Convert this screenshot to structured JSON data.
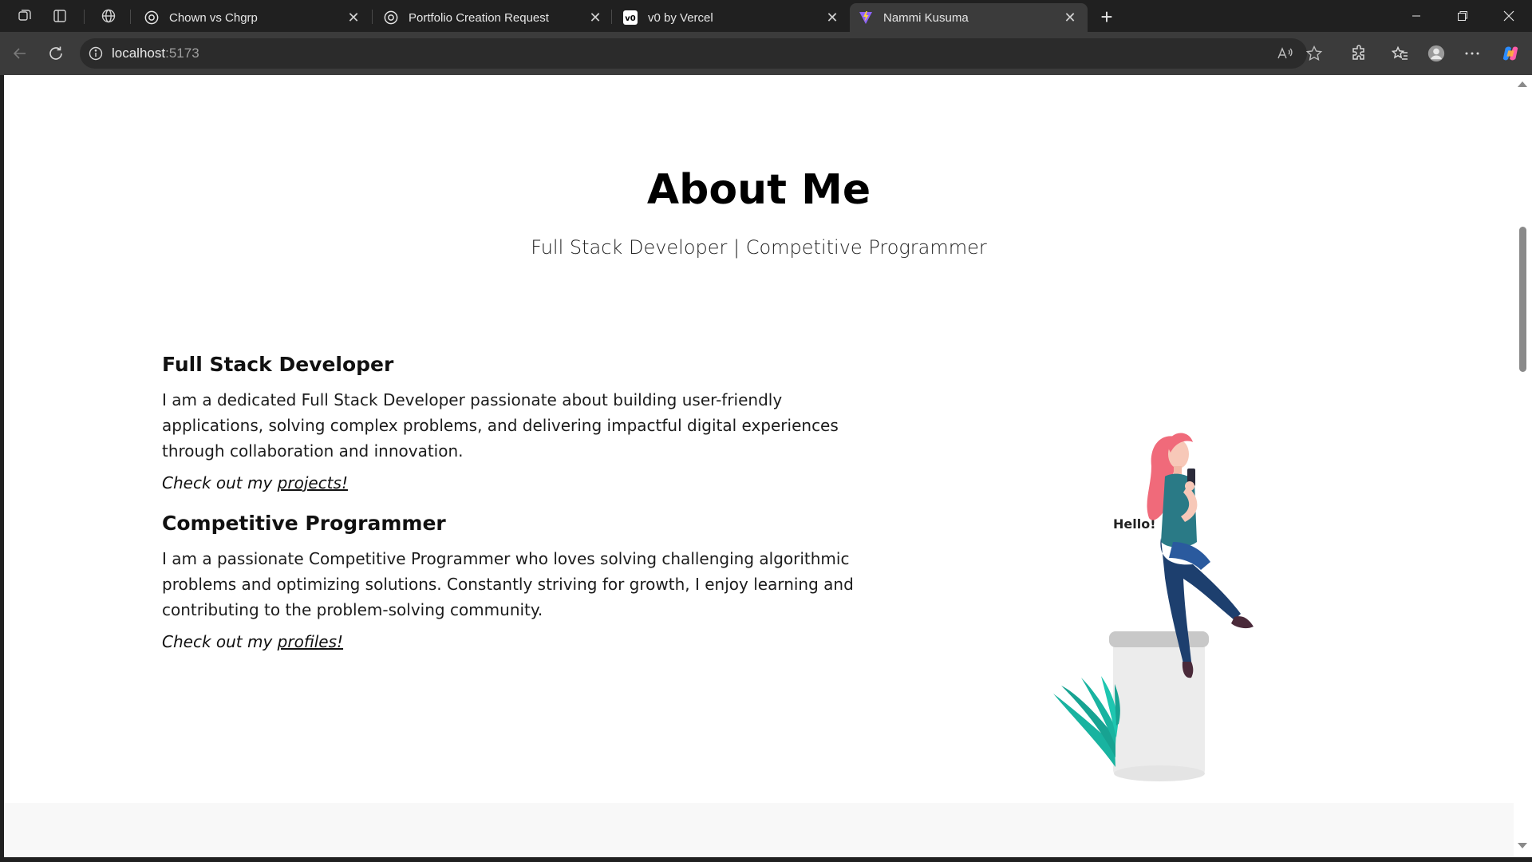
{
  "browser": {
    "tabs": [
      {
        "title": "Chown vs Chgrp",
        "favicon": "openai-icon"
      },
      {
        "title": "Portfolio Creation Request",
        "favicon": "openai-icon"
      },
      {
        "title": "v0 by Vercel",
        "favicon": "v0-icon"
      },
      {
        "title": "Nammi Kusuma",
        "favicon": "vite-icon",
        "active": true
      }
    ],
    "url_host": "localhost",
    "url_port": ":5173"
  },
  "page": {
    "heading": "About Me",
    "subheading": "Full Stack Developer | Competitive Programmer",
    "sections": [
      {
        "title": "Full Stack Developer",
        "body": "I am a dedicated Full Stack Developer passionate about building user-friendly applications, solving complex problems, and delivering impactful digital experiences through collaboration and innovation.",
        "cta_prefix": "Check out my ",
        "cta_link": "projects!"
      },
      {
        "title": "Competitive Programmer",
        "body": "I am a passionate Competitive Programmer who loves solving challenging algorithmic problems and optimizing solutions. Constantly striving for growth, I enjoy learning and contributing to the problem-solving community.",
        "cta_prefix": "Check out my ",
        "cta_link": "profiles!"
      }
    ],
    "illustration": {
      "speech_text": "Hello!"
    }
  },
  "colors": {
    "accent_plant": "#19b3a0",
    "hair": "#f06a7a",
    "shirt": "#2a7a86",
    "jeans": "#1d3f6e"
  }
}
